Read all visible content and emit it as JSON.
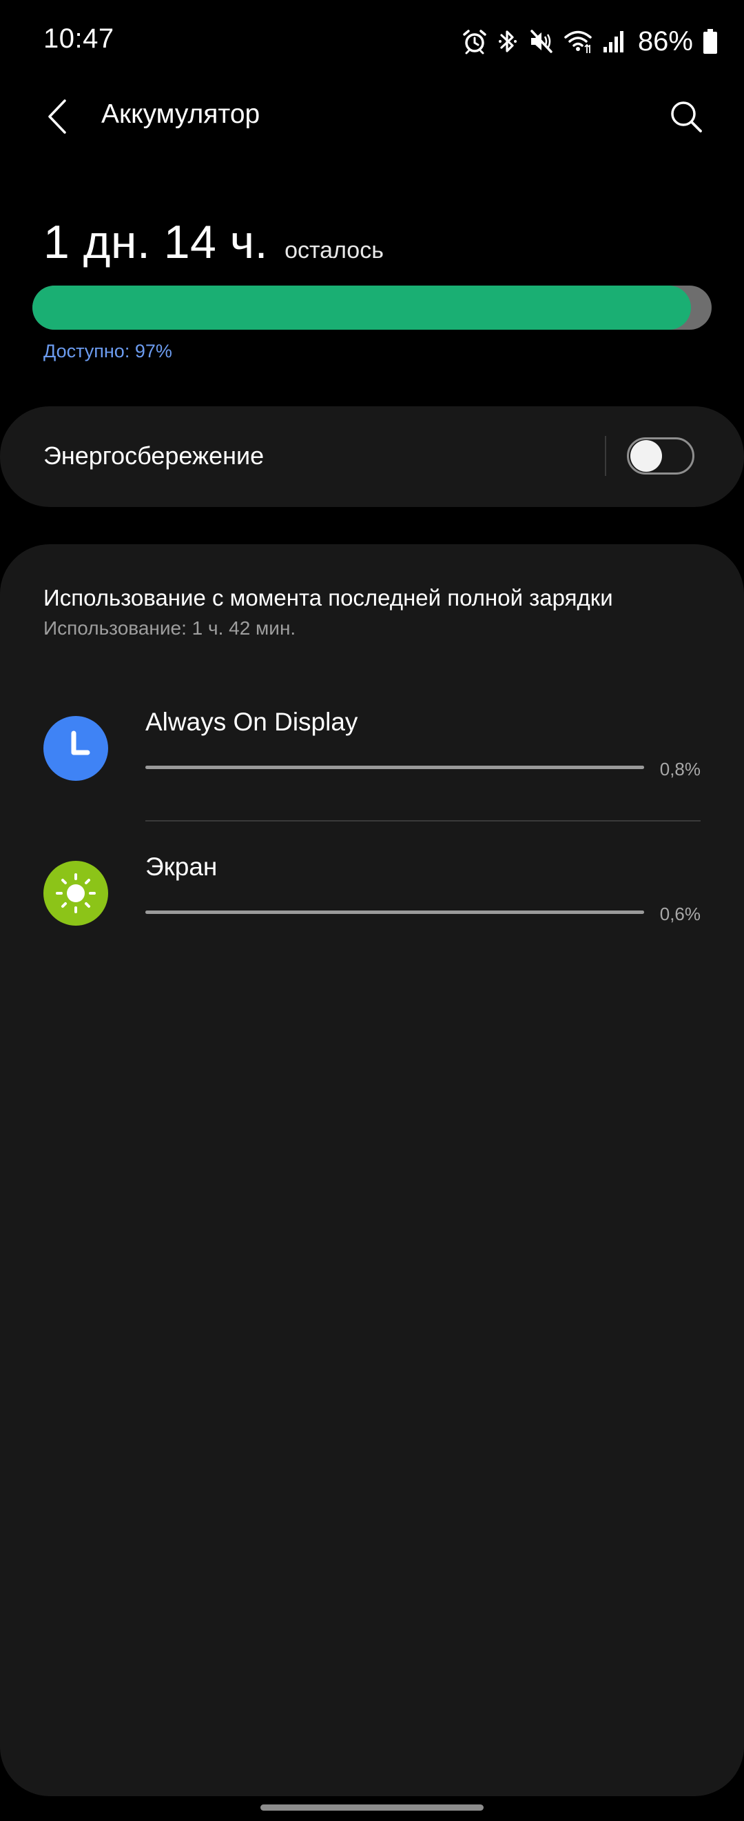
{
  "status_bar": {
    "time": "10:47",
    "battery_percent": "86%",
    "icons": [
      "alarm-icon",
      "bluetooth-icon",
      "vibrate-mute-icon",
      "wifi-icon",
      "cellular-signal-icon",
      "battery-icon"
    ]
  },
  "header": {
    "title": "Аккумулятор",
    "back_icon": "chevron-left-icon",
    "search_icon": "search-icon"
  },
  "battery": {
    "remaining_time": "1 дн. 14 ч.",
    "remaining_label": "осталось",
    "level_fraction": 0.97,
    "available_text": "Доступно: 97%",
    "fill_color": "#1aaf73"
  },
  "power_saving": {
    "label": "Энергосбережение",
    "enabled": false
  },
  "usage": {
    "title": "Использование с момента последней полной зарядки",
    "subtitle": "Использование: 1 ч. 42 мин.",
    "items": [
      {
        "name": "Always On Display",
        "percent_text": "0,8%",
        "usage_fraction": 1.0,
        "icon": "clock-icon",
        "icon_color": "#3f83f5"
      },
      {
        "name": "Экран",
        "percent_text": "0,6%",
        "usage_fraction": 1.0,
        "icon": "sun-icon",
        "icon_color": "#8cc418"
      }
    ]
  }
}
